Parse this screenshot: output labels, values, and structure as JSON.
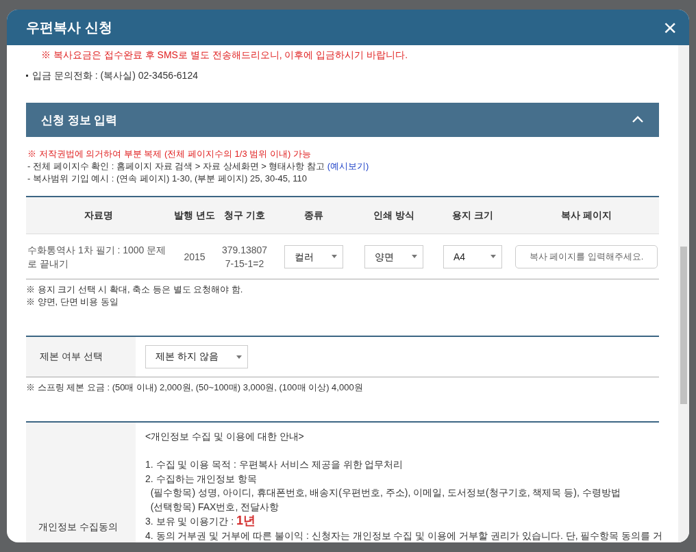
{
  "dialog": {
    "title": "우편복사 신청",
    "close": "×"
  },
  "notice": "※ 복사요금은 접수완료 후 SMS로 별도 전송해드리오니, 이후에 입금하시기 바랍니다.",
  "contact": "입금 문의전화 : (복사실) 02-3456-6124",
  "section": {
    "title": "신청 정보 입력",
    "expanded": true
  },
  "guide": {
    "warning": "※ 저작권법에 의거하여 부분 복제 (전체 페이지수의 1/3 범위 이내) 가능",
    "check": "- 전체 페이지수 확인 : 홈페이지 자료 검색 > 자료 상세화면 > 형태사항 참고",
    "link": "(예시보기)",
    "example": "- 복사범위 기입 예시 : (연속 페이지) 1-30, (부분 페이지) 25, 30-45, 110"
  },
  "table": {
    "columns": [
      "자료명",
      "발행 년도",
      "청구 기호",
      "종류",
      "인쇄 방식",
      "용지 크기",
      "복사 페이지"
    ],
    "rows": [
      {
        "title": "수화통역사 1차 필기 : 1000 문제로 끝내기",
        "year": "2015",
        "call_number": [
          "379.13807",
          "7-15-1=2"
        ],
        "type": "컬러",
        "print": "양면",
        "paper": "A4",
        "pages_placeholder": "복사 페이지를 입력해주세요."
      }
    ]
  },
  "table_notes": [
    "※ 용지 크기 선택 시 확대, 축소 등은 별도 요청해야 함.",
    "※ 양면, 단면 비용 동일"
  ],
  "binding": {
    "label": "제본 여부 선택",
    "value": "제본 하지 않음",
    "note": "※ 스프링 제본 요금 : (50매 이내) 2,000원, (50~100매) 3,000원, (100매 이상) 4,000원"
  },
  "consent": {
    "label": "개인정보 수집동의",
    "heading": "<개인정보 수집 및 이용에 대한 안내>",
    "lines": [
      "1. 수집 및 이용 목적 : 우편복사 서비스 제공을 위한 업무처리",
      "2. 수집하는 개인정보 항목",
      "  (필수항목) 성명, 아이디, 휴대폰번호, 배송지(우편번호, 주소), 이메일, 도서정보(청구기호, 책제목 등), 수령방법",
      "  (선택항목) FAX번호, 전달사항",
      "3. 보유 및 이용기간 : **1년**",
      "4. 동의 거부권 및 거부에 따른 불이익 : 신청자는 개인정보 수집 및 이용에 거부할 권리가 있습니다. 단, 필수항목 동의를 거"
    ]
  }
}
